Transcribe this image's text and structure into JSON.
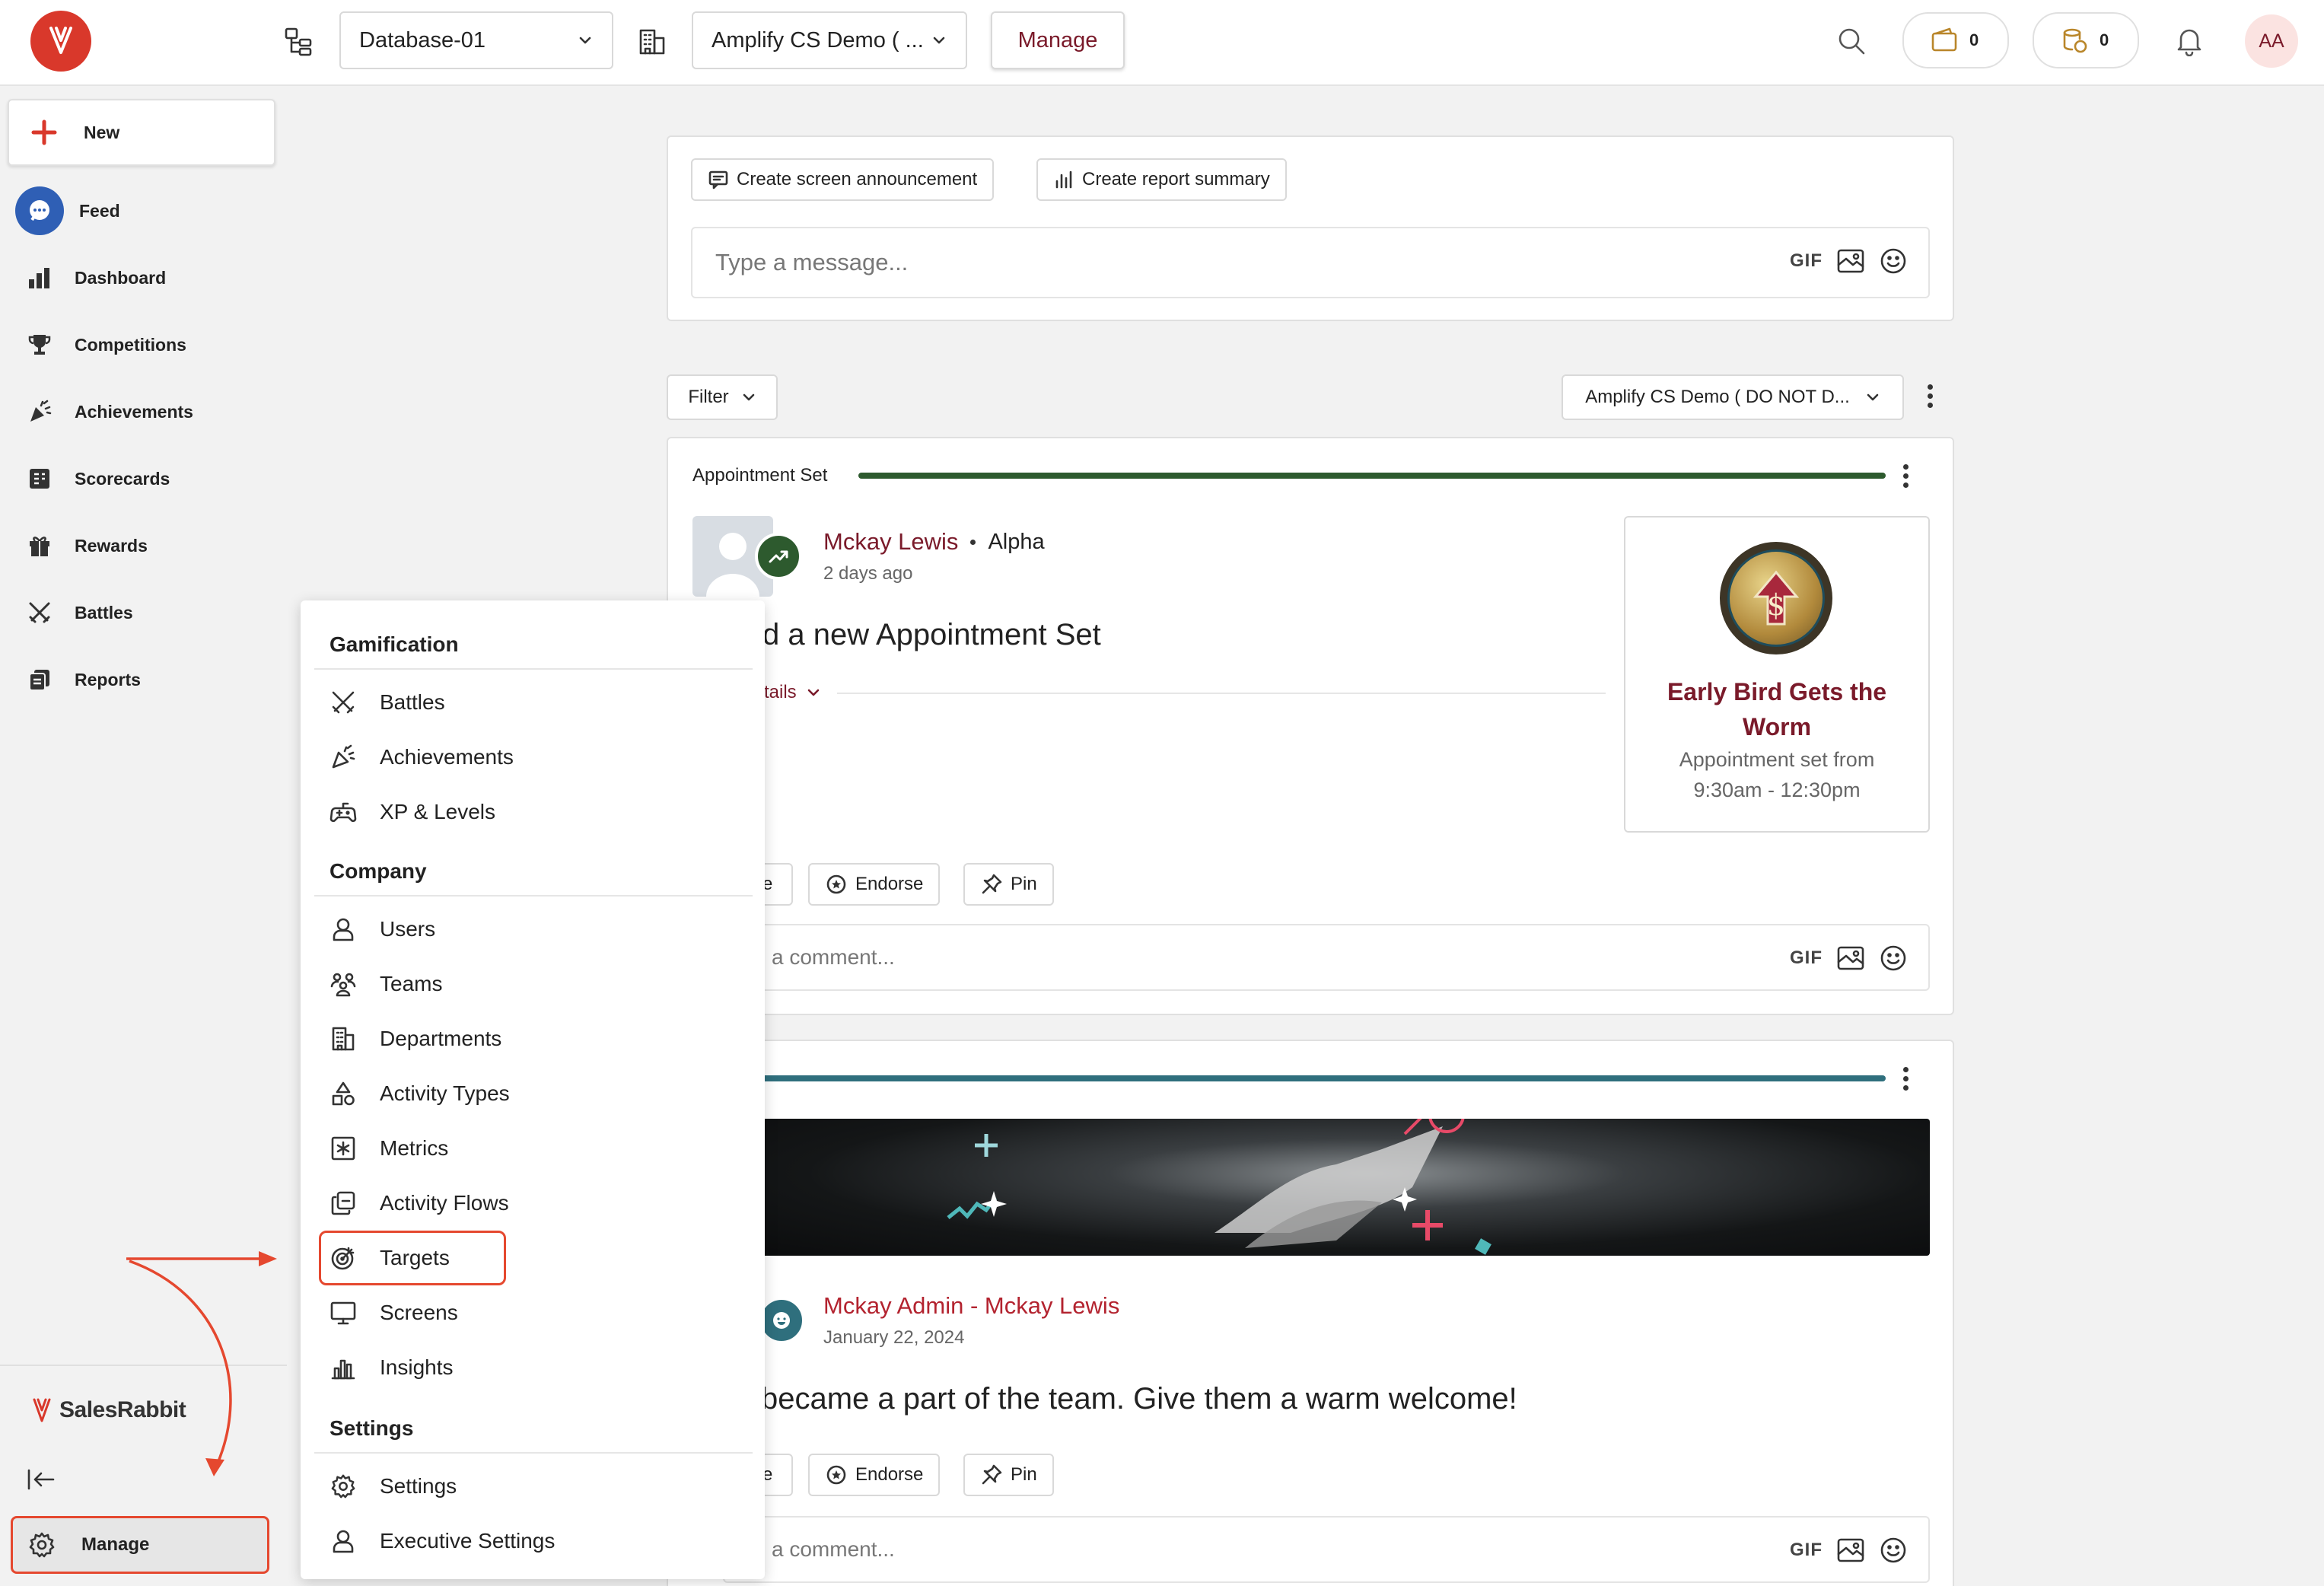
{
  "topbar": {
    "database_select": "Database-01",
    "company_select": "Amplify CS Demo ( ...",
    "manage_button": "Manage",
    "wallet_count": "0",
    "coins_count": "0",
    "avatar_initials": "AA"
  },
  "sidebar": {
    "new_label": "New",
    "items": [
      {
        "label": "Feed",
        "icon": "chat-bubble-icon"
      },
      {
        "label": "Dashboard",
        "icon": "bar-chart-icon"
      },
      {
        "label": "Competitions",
        "icon": "trophy-icon"
      },
      {
        "label": "Achievements",
        "icon": "confetti-icon"
      },
      {
        "label": "Scorecards",
        "icon": "scorecard-icon"
      },
      {
        "label": "Rewards",
        "icon": "gift-icon"
      },
      {
        "label": "Battles",
        "icon": "crossed-swords-icon"
      },
      {
        "label": "Reports",
        "icon": "reports-icon"
      }
    ],
    "brand": "SalesRabbit",
    "manage_label": "Manage"
  },
  "composer": {
    "announcement_button": "Create screen announcement",
    "report_button": "Create report summary",
    "placeholder": "Type a message...",
    "gif_label": "GIF"
  },
  "feed_controls": {
    "filter_label": "Filter",
    "company_filter": "Amplify CS Demo ( DO NOT D..."
  },
  "post1": {
    "category": "Appointment Set",
    "author": "Mckay Lewis",
    "team": "Alpha",
    "time": "2 days ago",
    "headline_visible": "d a new Appointment Set",
    "details_label": "tails",
    "award_title": "Early Bird Gets the Worm",
    "award_desc": "Appointment set from 9:30am - 12:30pm",
    "like_partial": "e",
    "endorse": "Endorse",
    "pin": "Pin",
    "comment_placeholder": "a comment...",
    "gif_label": "GIF"
  },
  "post2": {
    "author": "Mckay Admin - Mckay Lewis",
    "time": "January 22, 2024",
    "headline_visible": "became a part of the team. Give them a warm welcome!",
    "like_partial": "e",
    "endorse": "Endorse",
    "pin": "Pin",
    "comment_placeholder": "a comment...",
    "gif_label": "GIF"
  },
  "manage_menu": {
    "sections": [
      {
        "title": "Gamification",
        "items": [
          "Battles",
          "Achievements",
          "XP & Levels"
        ]
      },
      {
        "title": "Company",
        "items": [
          "Users",
          "Teams",
          "Departments",
          "Activity Types",
          "Metrics",
          "Activity Flows",
          "Targets",
          "Screens",
          "Insights"
        ]
      },
      {
        "title": "Settings",
        "items": [
          "Settings",
          "Executive Settings"
        ]
      }
    ],
    "highlighted_item": "Targets"
  },
  "colors": {
    "brand_red": "#d9382b",
    "annotation_red": "#e5482f",
    "progress_green": "#2d5a2e",
    "progress_teal": "#2f6f7d",
    "author_maroon": "#7a1a2a",
    "feed_blue": "#2f5fb5"
  }
}
